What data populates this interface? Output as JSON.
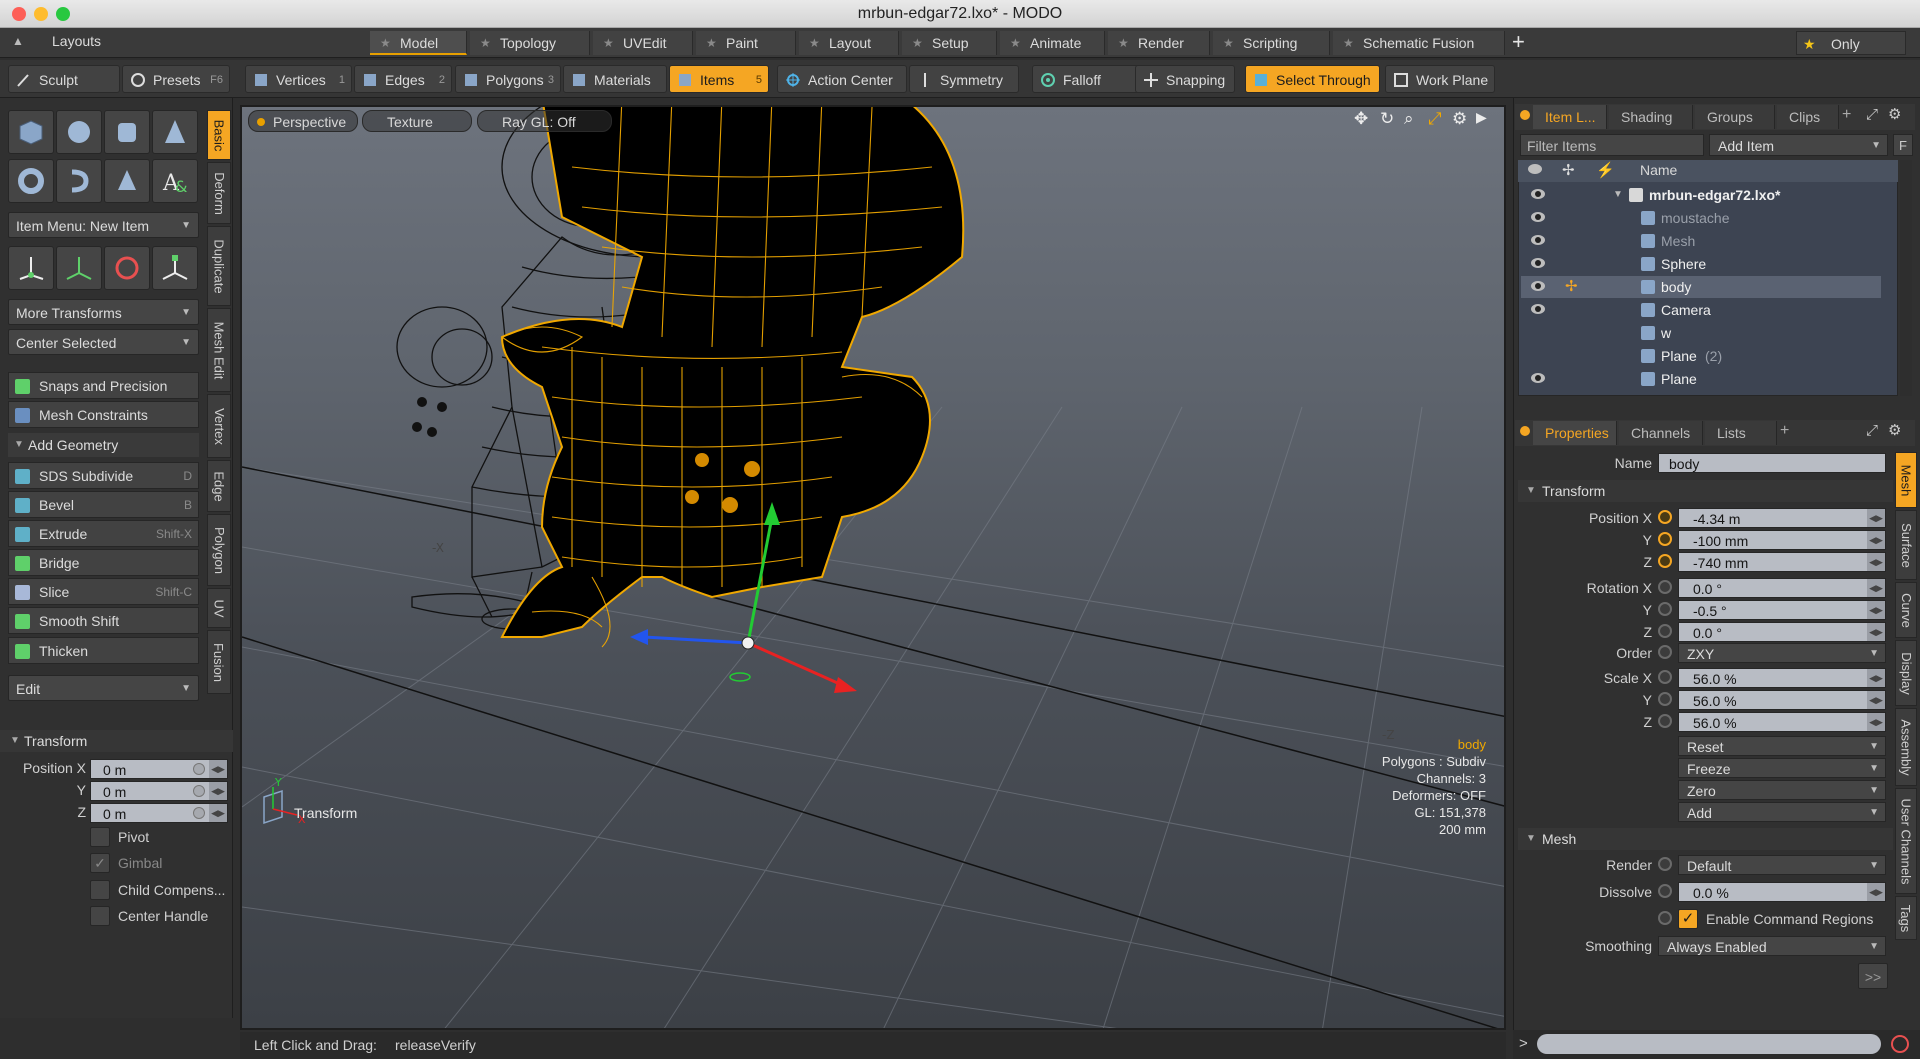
{
  "window": {
    "title": "mrbun-edgar72.lxo* - MODO"
  },
  "menubar": {
    "layouts": "Layouts",
    "tabs": [
      {
        "label": "Model",
        "active": true
      },
      {
        "label": "Topology"
      },
      {
        "label": "UVEdit"
      },
      {
        "label": "Paint"
      },
      {
        "label": "Layout"
      },
      {
        "label": "Setup"
      },
      {
        "label": "Animate"
      },
      {
        "label": "Render"
      },
      {
        "label": "Scripting"
      },
      {
        "label": "Schematic Fusion"
      }
    ],
    "add": "+",
    "only": "Only"
  },
  "toolbar": {
    "sculpt": "Sculpt",
    "presets": "Presets",
    "presets_shortcut": "F6",
    "buttons": [
      {
        "label": "Vertices",
        "shortcut": "1"
      },
      {
        "label": "Edges",
        "shortcut": "2"
      },
      {
        "label": "Polygons",
        "shortcut": "3"
      },
      {
        "label": "Materials",
        "shortcut": ""
      },
      {
        "label": "Items",
        "shortcut": "5",
        "active": true
      },
      {
        "label": "Action Center",
        "shortcut": ""
      },
      {
        "label": "Symmetry",
        "shortcut": ""
      },
      {
        "label": "Falloff",
        "shortcut": ""
      },
      {
        "label": "Snapping",
        "shortcut": ""
      },
      {
        "label": "Select Through",
        "shortcut": "",
        "active": true
      },
      {
        "label": "Work Plane",
        "shortcut": ""
      }
    ]
  },
  "left": {
    "item_menu": "Item Menu: New Item",
    "more_transforms": "More Transforms",
    "center_selected": "Center Selected",
    "snaps": "Snaps and Precision",
    "mesh_constraints": "Mesh Constraints",
    "add_geometry": "Add Geometry",
    "tools": [
      {
        "label": "SDS Subdivide",
        "shortcut": "D"
      },
      {
        "label": "Bevel",
        "shortcut": "B"
      },
      {
        "label": "Extrude",
        "shortcut": "Shift-X"
      },
      {
        "label": "Bridge",
        "shortcut": ""
      },
      {
        "label": "Slice",
        "shortcut": "Shift-C"
      },
      {
        "label": "Smooth Shift",
        "shortcut": ""
      },
      {
        "label": "Thicken",
        "shortcut": ""
      }
    ],
    "edit": "Edit",
    "vtabs": [
      "Basic",
      "Deform",
      "Duplicate",
      "Mesh Edit",
      "Vertex",
      "Edge",
      "Polygon",
      "UV",
      "Fusion"
    ],
    "transform": {
      "title": "Transform",
      "position_x_label": "Position X",
      "y_label": "Y",
      "z_label": "Z",
      "x": "0 m",
      "y": "0 m",
      "z": "0 m",
      "pivot": "Pivot",
      "gimbal": "Gimbal",
      "child": "Child Compens...",
      "center_handle": "Center Handle"
    }
  },
  "viewport": {
    "tabs": [
      "Perspective",
      "Texture",
      "Ray GL: Off"
    ],
    "hud": {
      "item": "body",
      "polygons": "Polygons : Subdiv",
      "channels": "Channels: 3",
      "deformers": "Deformers: OFF",
      "gl": "GL: 151,378",
      "scale": "200 mm"
    },
    "transform_label": "Transform",
    "axis_y": "Y",
    "axis_x": "X",
    "axis_z": "Z",
    "neg_x": "-X",
    "neg_z": "-Z"
  },
  "status": {
    "hint": "Left Click and Drag:",
    "command": "releaseVerify"
  },
  "right": {
    "top_tabs": [
      "Item L...",
      "Shading",
      "Groups",
      "Clips"
    ],
    "add_tab": "+",
    "filter_placeholder": "Filter Items",
    "add_item": "Add Item",
    "f_btn": "F",
    "name_header": "Name",
    "tree": [
      {
        "label": "mrbun-edgar72.lxo*",
        "indent": 0,
        "root": true,
        "eye": true
      },
      {
        "label": "moustache",
        "indent": 1,
        "dim": true,
        "eye": true
      },
      {
        "label": "Mesh",
        "indent": 1,
        "dim": true,
        "eye": true
      },
      {
        "label": "Sphere",
        "indent": 1,
        "eye": true
      },
      {
        "label": "body",
        "indent": 1,
        "selected": true,
        "eye": true
      },
      {
        "label": "Camera",
        "indent": 1,
        "eye": true
      },
      {
        "label": "w",
        "indent": 1,
        "eye": false
      },
      {
        "label": "Plane",
        "suffix": "(2)",
        "indent": 1,
        "eye": false
      },
      {
        "label": "Plane",
        "indent": 1,
        "eye": true
      }
    ],
    "prop_tabs": [
      "Properties",
      "Channels",
      "Lists"
    ],
    "name_label": "Name",
    "name_value": "body",
    "transform_title": "Transform",
    "position_x": "Position X",
    "rotation_x": "Rotation X",
    "scale_x": "Scale X",
    "order_label": "Order",
    "y_label": "Y",
    "z_label": "Z",
    "pos": [
      "-4.34 m",
      "-100 mm",
      "-740 mm"
    ],
    "rot": [
      "0.0 °",
      "-0.5 °",
      "0.0 °"
    ],
    "order": "ZXY",
    "scale": [
      "56.0 %",
      "56.0 %",
      "56.0 %"
    ],
    "actions": [
      "Reset",
      "Freeze",
      "Zero",
      "Add"
    ],
    "mesh_title": "Mesh",
    "render_label": "Render",
    "render_value": "Default",
    "dissolve_label": "Dissolve",
    "dissolve_value": "0.0 %",
    "enable_cmd": "Enable Command Regions",
    "smoothing_label": "Smoothing",
    "smoothing_value": "Always Enabled",
    "more": ">>",
    "vtabs": [
      "Mesh",
      "Surface",
      "Curve",
      "Display",
      "Assembly",
      "User Channels",
      "Tags"
    ],
    "cmd_prompt": ">"
  },
  "colors": {
    "accent": "#f5a623",
    "wire": "#f0a800"
  }
}
